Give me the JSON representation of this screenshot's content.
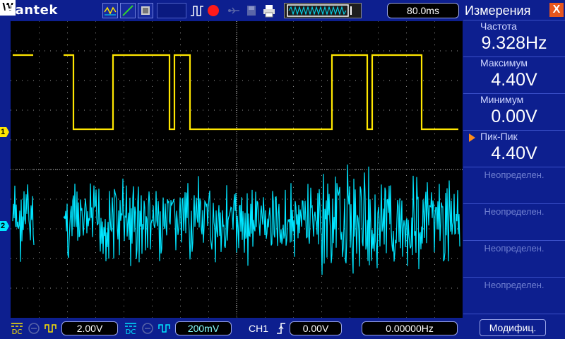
{
  "brand": "Hantek",
  "toolbar": {
    "w_label": "W",
    "timebase": "80.0ms",
    "icons": [
      "waveform-mode-icon",
      "line-mode-icon",
      "persist-icon",
      "run-pulse-icon",
      "record-icon",
      "usb-icon",
      "disk-icon",
      "print-icon",
      "memory-waveform-icon"
    ]
  },
  "channels": {
    "ch1": {
      "marker": "1",
      "color": "#ffe600",
      "coupling": "DC",
      "volts_div": "2.00V"
    },
    "ch2": {
      "marker": "2",
      "color": "#00e5ff",
      "coupling": "DC",
      "volts_div": "200mV"
    }
  },
  "trigger": {
    "source": "CH1",
    "level": "0.00V",
    "frequency": "0.00000Hz"
  },
  "measurements": {
    "title": "Измерения",
    "close_label": "X",
    "items": [
      {
        "label": "Частота",
        "value": "9.328Hz"
      },
      {
        "label": "Максимум",
        "value": "4.40V"
      },
      {
        "label": "Минимум",
        "value": "0.00V"
      },
      {
        "label": "Пик-Пик",
        "value": "4.40V",
        "selected": true
      }
    ],
    "undefined_items": [
      "Неопределен.",
      "Неопределен.",
      "Неопределен.",
      "Неопределен."
    ],
    "modify_label": "Модифиц."
  },
  "colors": {
    "background": "#0d1f8f",
    "screen": "#000000",
    "accent": "#e8561e"
  }
}
